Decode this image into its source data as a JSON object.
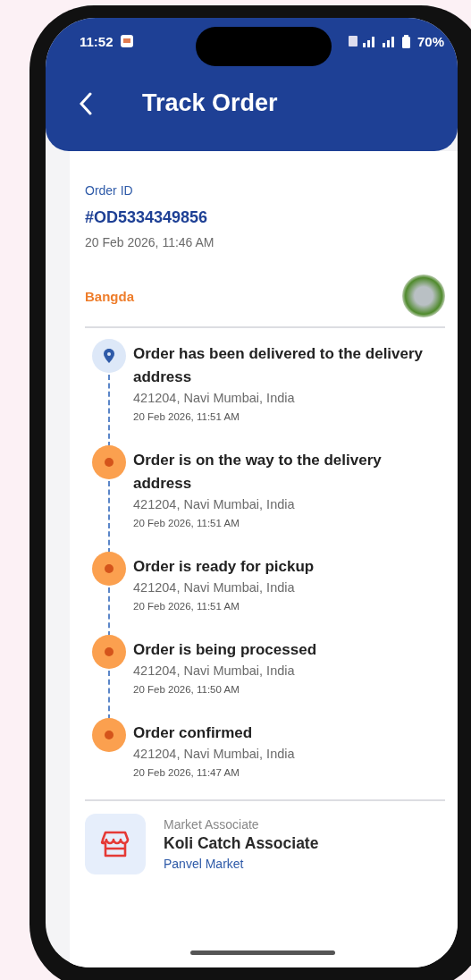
{
  "status_bar": {
    "time": "11:52",
    "battery": "70%"
  },
  "header": {
    "title": "Track Order"
  },
  "order": {
    "id_label": "Order ID",
    "id": "#OD5334349856",
    "date": "20 Feb 2026, 11:46 AM",
    "product": "Bangda"
  },
  "timeline": [
    {
      "kind": "current",
      "title": "Order has been delivered to the delivery address",
      "location": "421204, Navi Mumbai, India",
      "time": "20 Feb 2026, 11:51 AM"
    },
    {
      "kind": "done",
      "title": "Order is on the way to the delivery address",
      "location": "421204, Navi Mumbai, India",
      "time": "20 Feb 2026, 11:51 AM"
    },
    {
      "kind": "done",
      "title": "Order is ready for pickup",
      "location": "421204, Navi Mumbai, India",
      "time": "20 Feb 2026, 11:51 AM"
    },
    {
      "kind": "done",
      "title": "Order is being processed",
      "location": "421204, Navi Mumbai, India",
      "time": "20 Feb 2026, 11:50 AM"
    },
    {
      "kind": "done",
      "title": "Order confirmed",
      "location": "421204, Navi Mumbai, India",
      "time": "20 Feb 2026, 11:47 AM"
    }
  ],
  "associate": {
    "label": "Market Associate",
    "name": "Koli Catch Associate",
    "market": "Panvel Market"
  }
}
